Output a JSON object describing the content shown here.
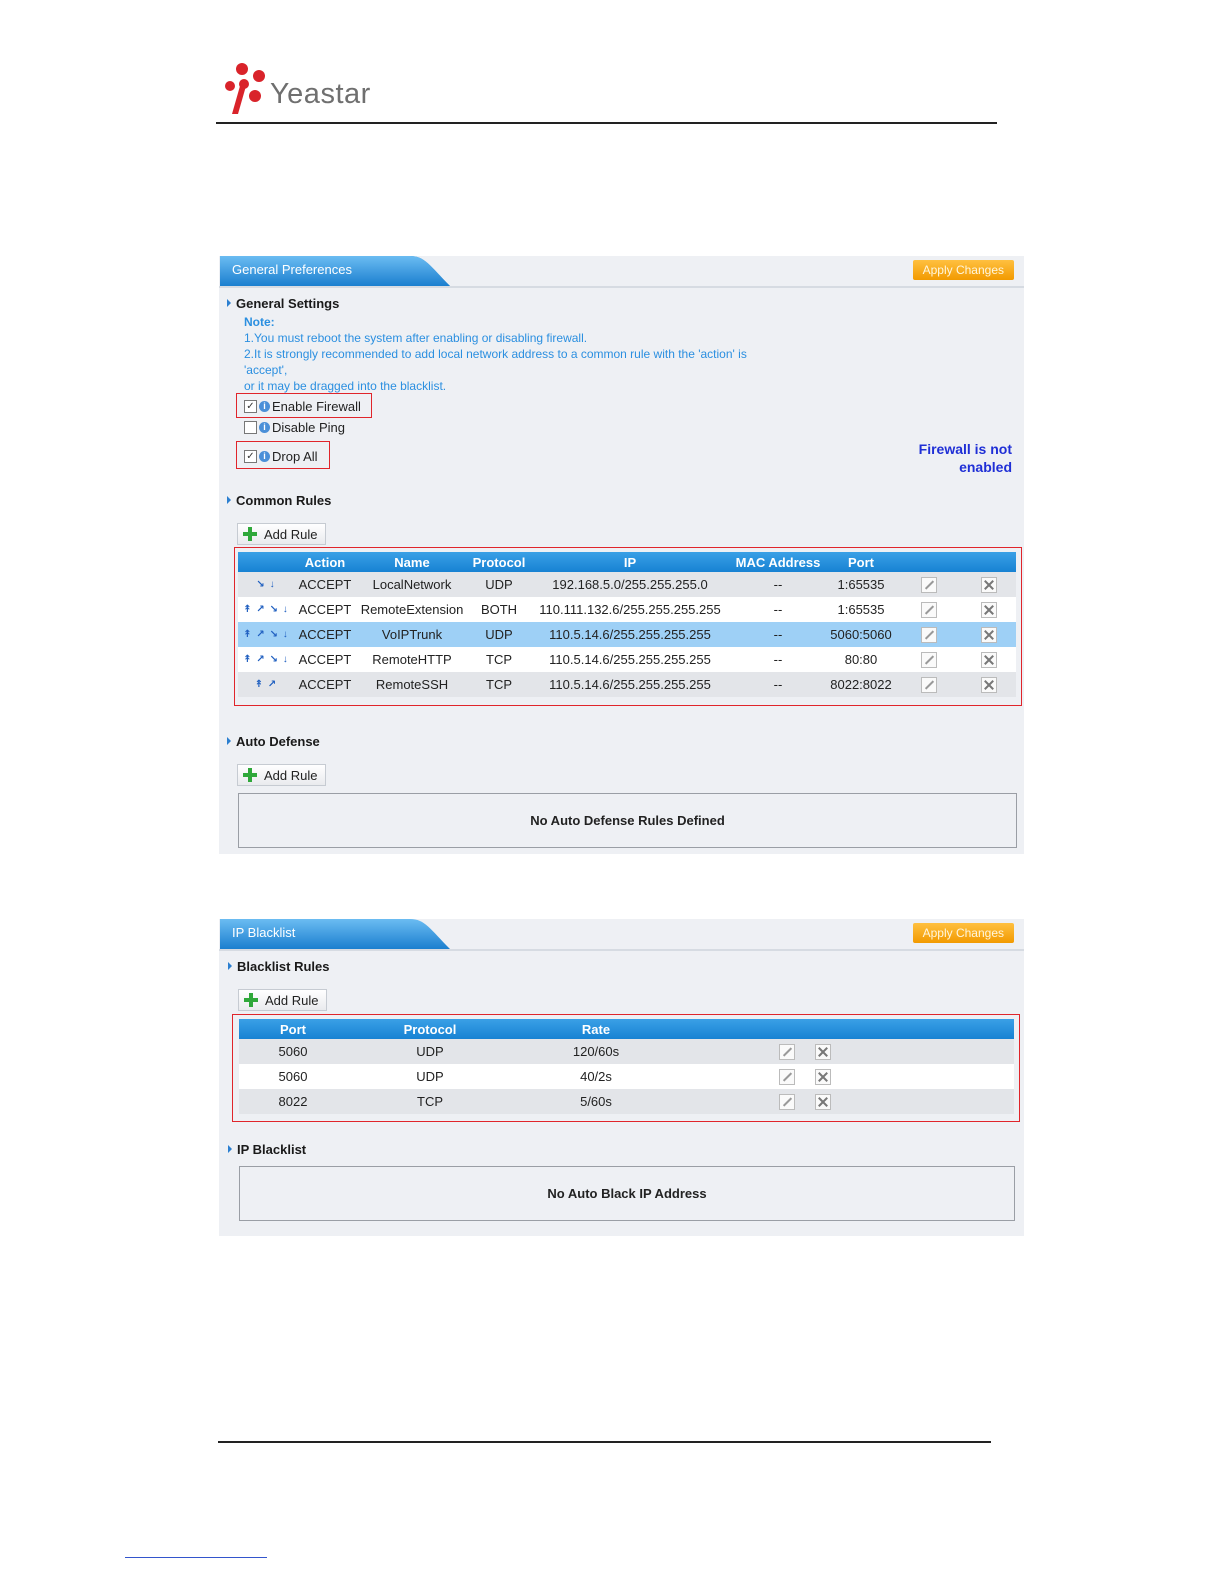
{
  "brand": {
    "name": "Yeastar"
  },
  "general_panel": {
    "tab_label": "General Preferences",
    "apply_label": "Apply Changes",
    "general_settings": {
      "title": "General Settings",
      "note_title": "Note:",
      "note_lines": [
        "1.You must reboot the system after enabling or disabling firewall.",
        "2.It is strongly recommended to add local network address to a common rule with the 'action' is",
        "'accept',",
        "or it may be dragged into the blacklist."
      ],
      "enable_firewall": {
        "label": "Enable Firewall",
        "checked": true
      },
      "disable_ping": {
        "label": "Disable Ping",
        "checked": false
      },
      "drop_all": {
        "label": "Drop All",
        "checked": true
      },
      "status_line1": "Firewall is not",
      "status_line2": "enabled"
    },
    "common_rules": {
      "title": "Common Rules",
      "add_label": "Add Rule",
      "columns": [
        "Action",
        "Name",
        "Protocol",
        "IP",
        "MAC Address",
        "Port"
      ],
      "rows": [
        {
          "arrows": "↘ ↓",
          "action": "ACCEPT",
          "name": "LocalNetwork",
          "protocol": "UDP",
          "ip": "192.168.5.0/255.255.255.0",
          "mac": "--",
          "port": "1:65535"
        },
        {
          "arrows": "↟ ↗ ↘ ↓",
          "action": "ACCEPT",
          "name": "RemoteExtension",
          "protocol": "BOTH",
          "ip": "110.111.132.6/255.255.255.255",
          "mac": "--",
          "port": "1:65535"
        },
        {
          "arrows": "↟ ↗ ↘ ↓",
          "action": "ACCEPT",
          "name": "VoIPTrunk",
          "protocol": "UDP",
          "ip": "110.5.14.6/255.255.255.255",
          "mac": "--",
          "port": "5060:5060"
        },
        {
          "arrows": "↟ ↗ ↘ ↓",
          "action": "ACCEPT",
          "name": "RemoteHTTP",
          "protocol": "TCP",
          "ip": "110.5.14.6/255.255.255.255",
          "mac": "--",
          "port": "80:80"
        },
        {
          "arrows": "↟ ↗",
          "action": "ACCEPT",
          "name": "RemoteSSH",
          "protocol": "TCP",
          "ip": "110.5.14.6/255.255.255.255",
          "mac": "--",
          "port": "8022:8022"
        }
      ]
    },
    "auto_defense": {
      "title": "Auto Defense",
      "add_label": "Add Rule",
      "empty_text": "No Auto Defense Rules Defined"
    }
  },
  "blacklist_panel": {
    "tab_label": "IP Blacklist",
    "apply_label": "Apply Changes",
    "rules": {
      "title": "Blacklist Rules",
      "add_label": "Add Rule",
      "columns": [
        "Port",
        "Protocol",
        "Rate"
      ],
      "rows": [
        {
          "port": "5060",
          "protocol": "UDP",
          "rate": "120/60s"
        },
        {
          "port": "5060",
          "protocol": "UDP",
          "rate": "40/2s"
        },
        {
          "port": "8022",
          "protocol": "TCP",
          "rate": "5/60s"
        }
      ]
    },
    "ip_blacklist": {
      "title": "IP Blacklist",
      "empty_text": "No Auto Black IP Address"
    }
  },
  "colors": {
    "accent": "#1782d3",
    "apply": "#f29a00",
    "highlight": "#e0252b",
    "status": "#1f2fd6"
  }
}
